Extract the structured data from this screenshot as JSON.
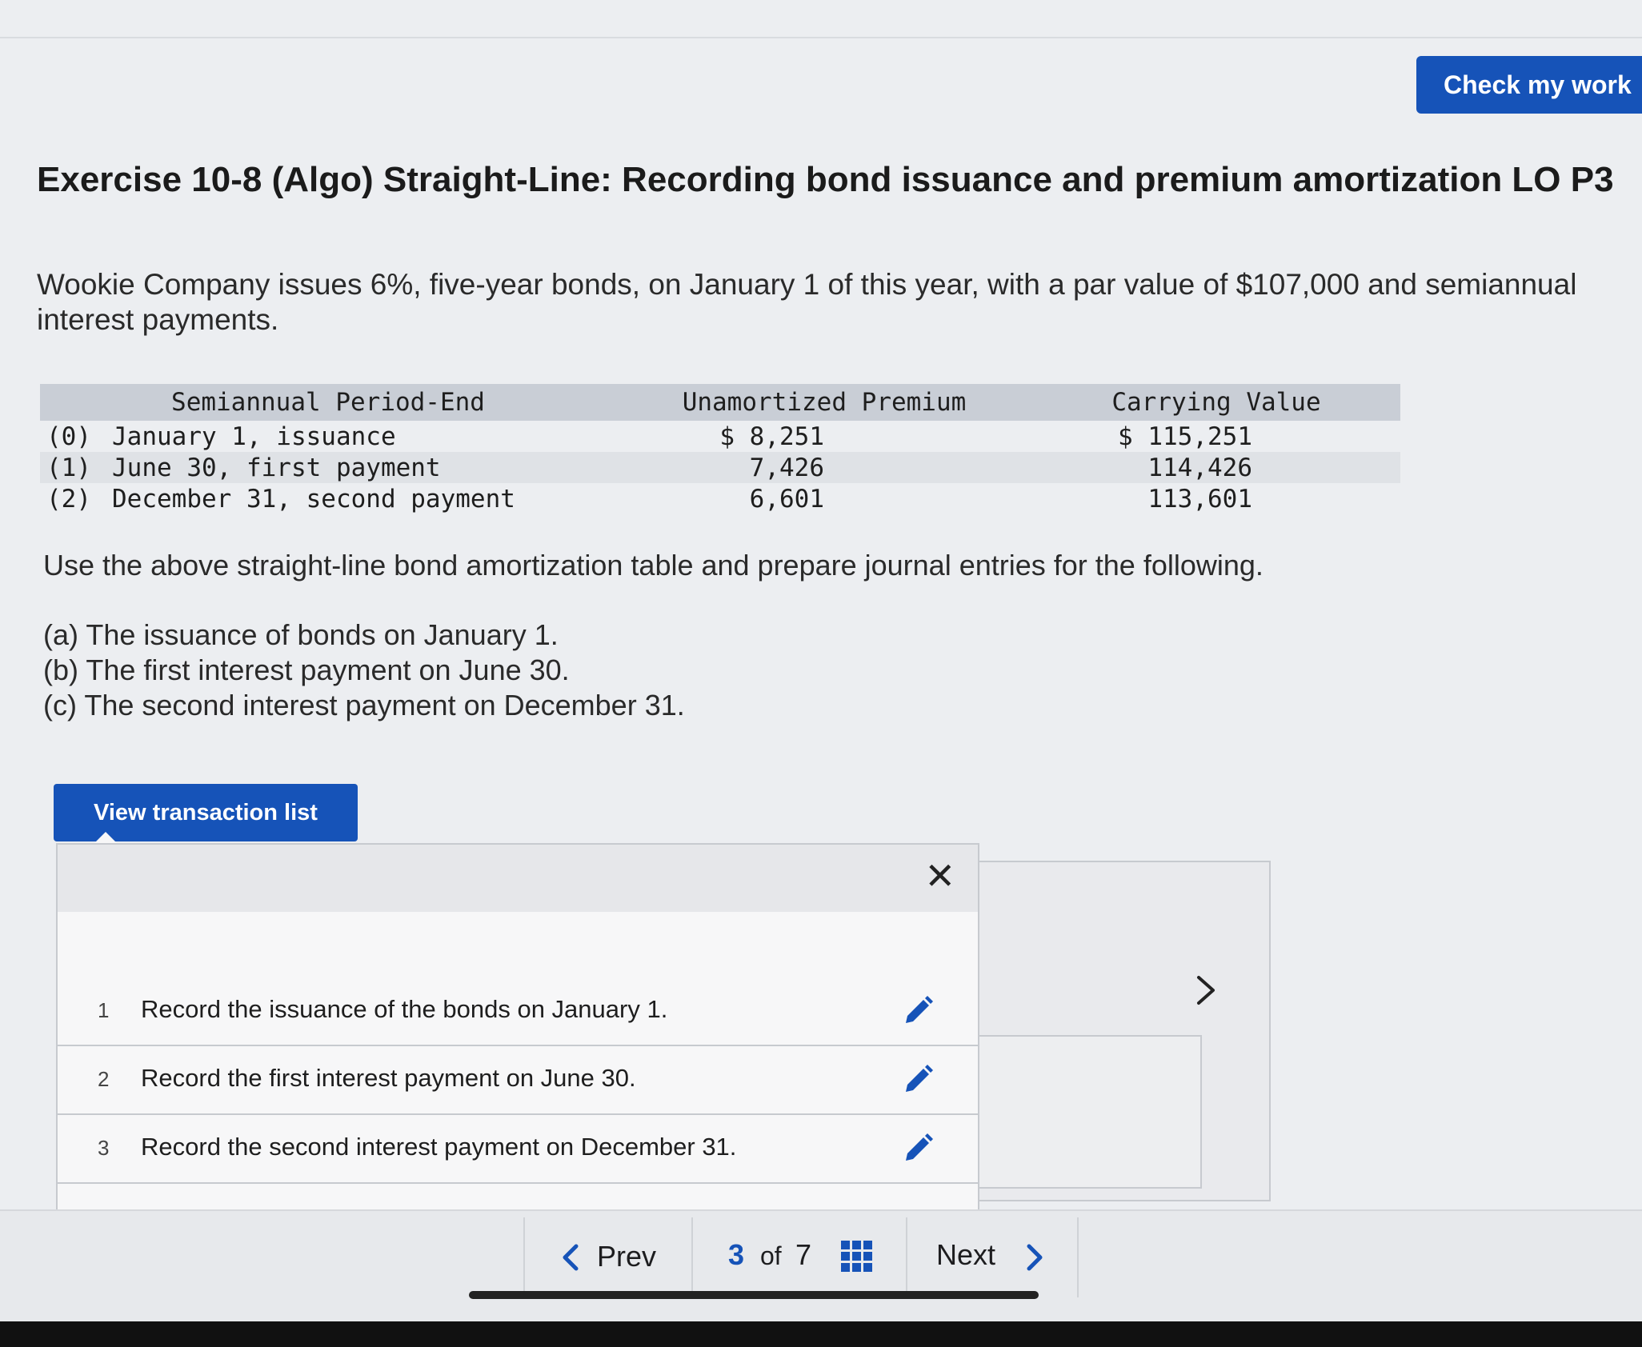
{
  "header": {
    "check_button": "Check my work"
  },
  "exercise": {
    "title": "Exercise 10-8 (Algo) Straight-Line: Recording bond issuance and premium amortization LO P3",
    "intro": "Wookie Company issues 6%, five-year bonds, on January 1 of this year, with a par value of $107,000 and semiannual interest payments."
  },
  "table": {
    "headers": [
      "Semiannual Period-End",
      "Unamortized Premium",
      "Carrying Value"
    ],
    "rows": [
      {
        "index": "(0)",
        "period": "January 1, issuance",
        "premium": "$ 8,251",
        "carrying": "$ 115,251"
      },
      {
        "index": "(1)",
        "period": "June 30, first payment",
        "premium": "7,426",
        "carrying": "114,426"
      },
      {
        "index": "(2)",
        "period": "December 31, second payment",
        "premium": "6,601",
        "carrying": "113,601"
      }
    ]
  },
  "instruction": "Use the above straight-line bond amortization table and prepare journal entries for the following.",
  "parts": [
    "(a) The issuance of bonds on January 1.",
    "(b) The first interest payment on June 30.",
    "(c) The second interest payment on December 31."
  ],
  "transactions": {
    "button_label": "View transaction list",
    "items": [
      {
        "num": "1",
        "label": "Record the issuance of the bonds on January 1."
      },
      {
        "num": "2",
        "label": "Record the first interest payment on June 30."
      },
      {
        "num": "3",
        "label": "Record the second interest payment on December 31."
      }
    ]
  },
  "navigation": {
    "prev": "Prev",
    "current": "3",
    "of": "of",
    "total": "7",
    "next": "Next"
  },
  "colors": {
    "accent": "#1653b8",
    "table_header": "#c9ced6"
  },
  "icons": [
    "close-icon",
    "pencil-icon",
    "chevron-right-icon",
    "chevron-left-icon",
    "grid-icon"
  ]
}
